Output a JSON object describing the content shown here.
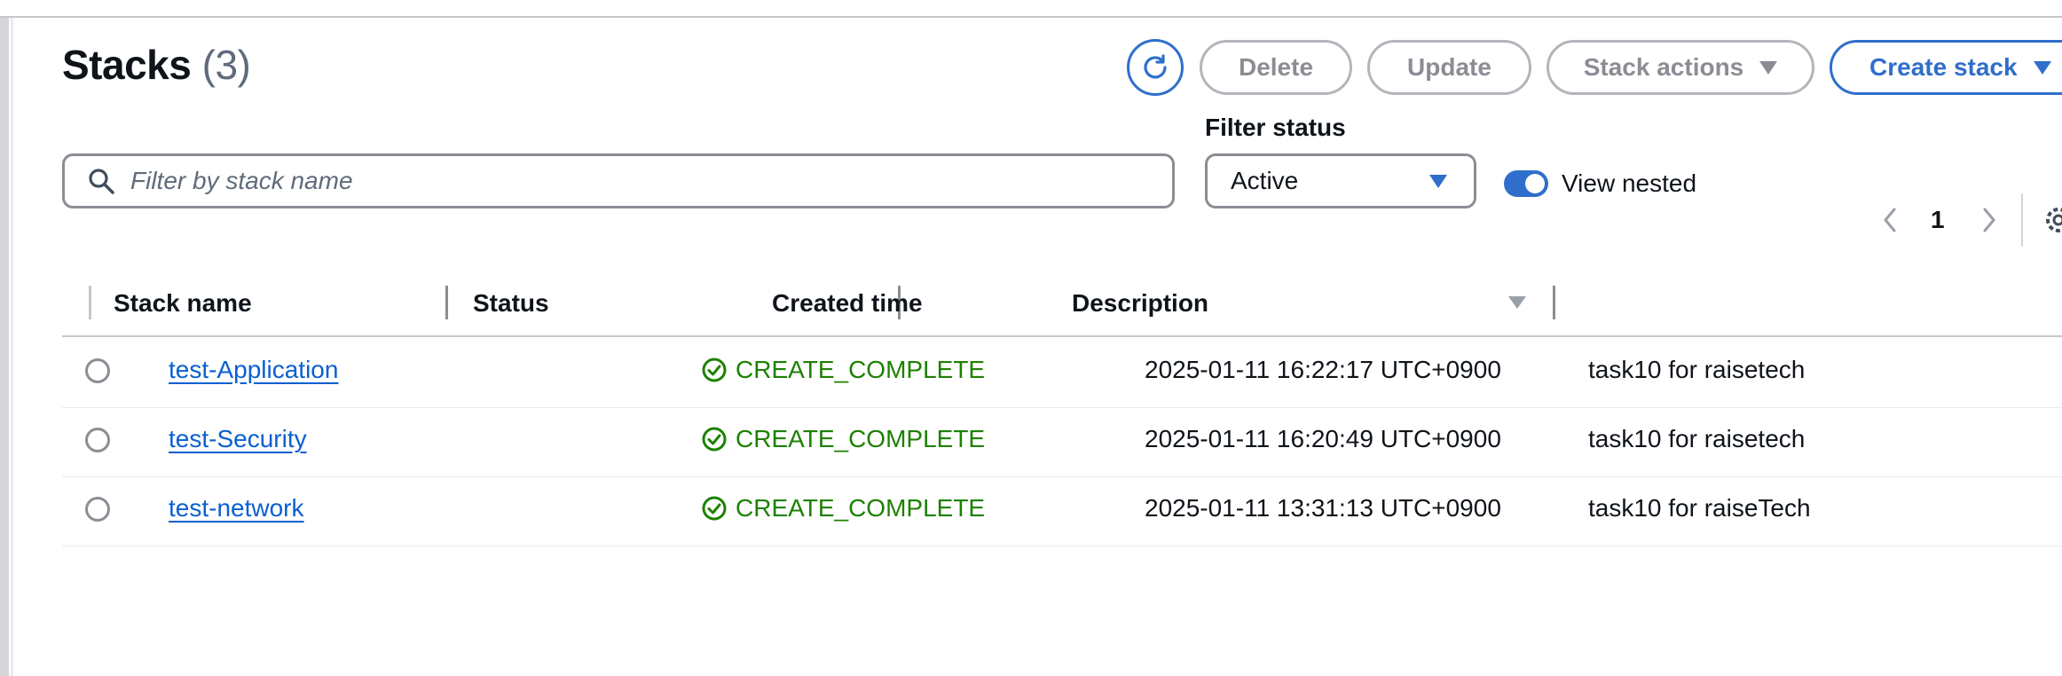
{
  "header": {
    "title": "Stacks",
    "count": "(3)",
    "buttons": {
      "delete": "Delete",
      "update": "Update",
      "stack_actions": "Stack actions",
      "create_stack": "Create stack"
    }
  },
  "filters": {
    "search_placeholder": "Filter by stack name",
    "status_label": "Filter status",
    "status_value": "Active",
    "view_nested_label": "View nested",
    "view_nested_enabled": true
  },
  "pagination": {
    "current_page": "1"
  },
  "table": {
    "columns": [
      "Stack name",
      "Status",
      "Created time",
      "Description"
    ],
    "rows": [
      {
        "name": "test-Application",
        "status": "CREATE_COMPLETE",
        "created_time": "2025-01-11 16:22:17 UTC+0900",
        "description": "task10 for raisetech"
      },
      {
        "name": "test-Security",
        "status": "CREATE_COMPLETE",
        "created_time": "2025-01-11 16:20:49 UTC+0900",
        "description": "task10 for raisetech"
      },
      {
        "name": "test-network",
        "status": "CREATE_COMPLETE",
        "created_time": "2025-01-11 13:31:13 UTC+0900",
        "description": "task10 for raiseTech"
      }
    ]
  },
  "colors": {
    "accent": "#2f6ecb",
    "link": "#0a5fd1",
    "success": "#1d8102",
    "disabled": "#8c8c94"
  },
  "icons": {
    "refresh": "refresh-icon",
    "search": "search-icon",
    "status": "check-circle-icon",
    "settings": "gear-icon"
  }
}
